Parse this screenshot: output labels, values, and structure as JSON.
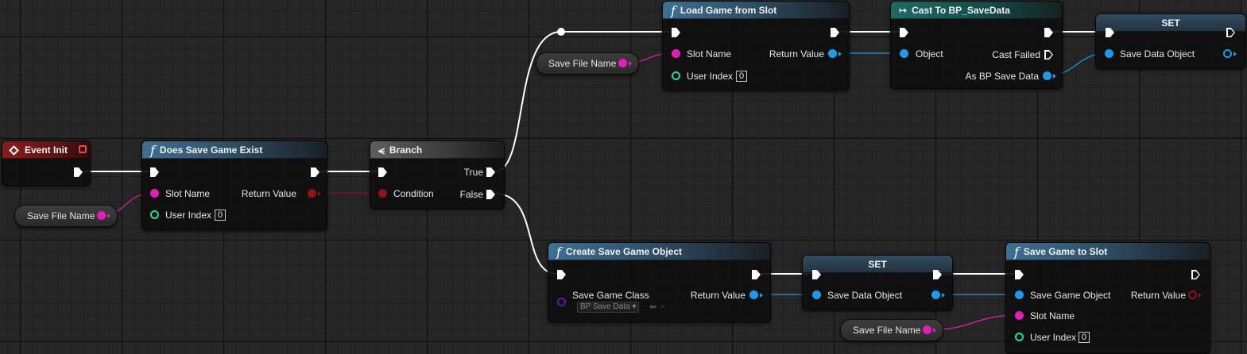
{
  "nodes": {
    "event_init": {
      "title": "Event Init"
    },
    "does_save_game_exist": {
      "title": "Does Save Game Exist",
      "pins": {
        "slot_name": "Slot Name",
        "user_index": "User Index",
        "user_index_value": "0",
        "return_value": "Return Value"
      }
    },
    "branch": {
      "title": "Branch",
      "pins": {
        "condition": "Condition",
        "true": "True",
        "false": "False"
      }
    },
    "load_game_from_slot": {
      "title": "Load Game from Slot",
      "pins": {
        "slot_name": "Slot Name",
        "user_index": "User Index",
        "user_index_value": "0",
        "return_value": "Return Value"
      }
    },
    "cast_to_bp_savedata": {
      "title": "Cast To BP_SaveData",
      "pins": {
        "object": "Object",
        "cast_failed": "Cast Failed",
        "as_bp_save_data": "As BP Save Data"
      }
    },
    "set_top": {
      "title": "SET",
      "pins": {
        "save_data_object": "Save Data Object"
      }
    },
    "create_save_game_object": {
      "title": "Create Save Game Object",
      "pins": {
        "save_game_class": "Save Game Class",
        "class_value": "BP Save Data",
        "return_value": "Return Value"
      }
    },
    "set_bottom": {
      "title": "SET",
      "pins": {
        "save_data_object": "Save Data Object"
      }
    },
    "save_game_to_slot": {
      "title": "Save Game to Slot",
      "pins": {
        "save_game_object": "Save Game Object",
        "slot_name": "Slot Name",
        "user_index": "User Index",
        "user_index_value": "0",
        "return_value": "Return Value"
      }
    }
  },
  "variables": {
    "save_file_name_1": "Save File Name",
    "save_file_name_2": "Save File Name",
    "save_file_name_3": "Save File Name"
  },
  "colors": {
    "exec_wire": "#ffffff",
    "string_pin": "#e01fb8",
    "object_pin": "#1e9be8",
    "bool_pin": "#8c1414",
    "int_pin": "#1fdc9c",
    "class_pin": "#5a1aa8"
  },
  "icons": {
    "function": "function-f-icon",
    "event": "event-diamond-icon",
    "branch": "branch-icon",
    "cast": "cast-arrow-icon"
  }
}
